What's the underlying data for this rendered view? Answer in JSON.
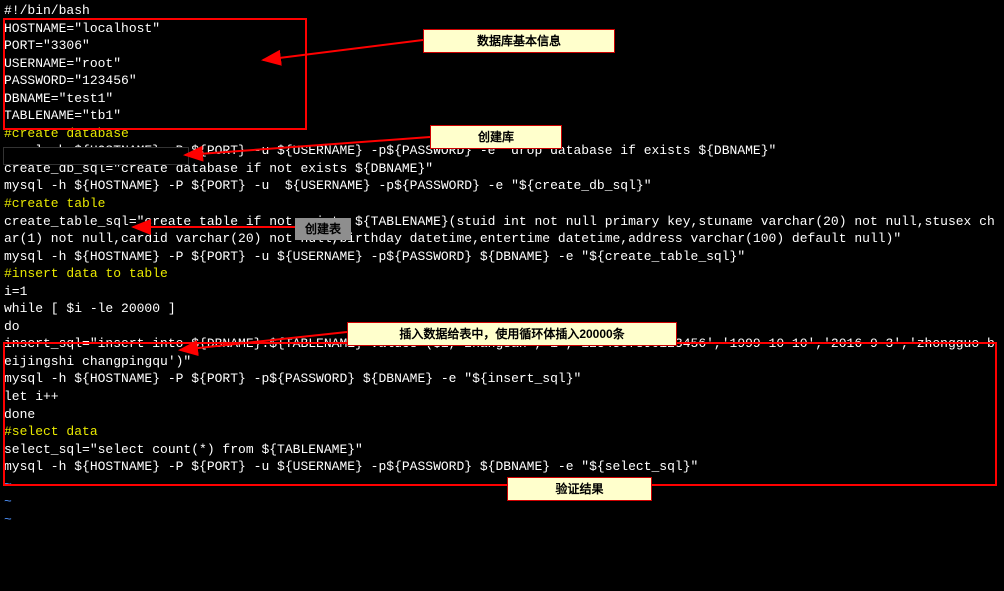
{
  "code": {
    "l1": "#!/bin/bash",
    "l2": "HOSTNAME=\"localhost\"",
    "l3": "PORT=\"3306\"",
    "l4": "USERNAME=\"root\"",
    "l5": "PASSWORD=\"123456\"",
    "l6": "DBNAME=\"test1\"",
    "l7": "TABLENAME=\"tb1\"",
    "l8": "#create database",
    "l9": "mysql -h ${HOSTNAME} -P ${PORT} -u ${USERNAME} -p${PASSWORD} -e \"drop database if exists ${DBNAME}\"",
    "l10": "create_db_sql=\"create database if not exists ${DBNAME}\"",
    "l11": "mysql -h ${HOSTNAME} -P ${PORT} -u  ${USERNAME} -p${PASSWORD} -e \"${create_db_sql}\"",
    "l12": "#create table",
    "l13": "create_table_sql=\"create table if not exists ${TABLENAME}(stuid int not null primary key,stuname varchar(20) not null,stusex char(1) not null,cardid varchar(20) not null,birthday datetime,entertime datetime,address varchar(100) default null)\"",
    "l14": "mysql -h ${HOSTNAME} -P ${PORT} -u ${USERNAME} -p${PASSWORD} ${DBNAME} -e \"${create_table_sql}\"",
    "l15": "",
    "l16": "#insert data to table",
    "l17": "i=1",
    "l18": "while [ $i -le 20000 ]",
    "l19": "do",
    "l20": "insert_sql=\"insert into ${DBNAME}.${TABLENAME} values ($i,'zhangsan','1','1234567890123456','1999-10-10','2016-9-3','zhongguo beijingshi changpingqu')\"",
    "l21": "mysql -h ${HOSTNAME} -P ${PORT} -p${PASSWORD} ${DBNAME} -e \"${insert_sql}\"",
    "l22": "let i++",
    "l23": "done",
    "l24": "#select data",
    "l25": "select_sql=\"select count(*) from ${TABLENAME}\"",
    "l26": "mysql -h ${HOSTNAME} -P ${PORT} -u ${USERNAME} -p${PASSWORD} ${DBNAME} -e \"${select_sql}\"",
    "tilde": "~"
  },
  "callouts": {
    "dbinfo": "数据库基本信息",
    "createdb": "创建库",
    "createtable": "创建表",
    "insert": "插入数据给表中，使用循环体插入20000条",
    "verify": "验证结果"
  }
}
